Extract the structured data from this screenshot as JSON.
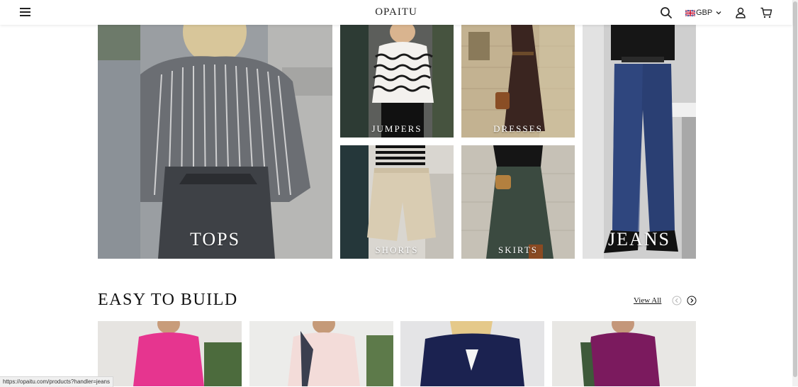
{
  "header": {
    "logo": "OPAITU",
    "currency": "GBP",
    "icons": [
      "menu-icon",
      "search-icon",
      "flag-uk-icon",
      "chevron-down-icon",
      "user-icon",
      "cart-icon"
    ]
  },
  "categories": [
    {
      "label": "TOPS"
    },
    {
      "label": "JUMPERS"
    },
    {
      "label": "DRESSES"
    },
    {
      "label": "JEANS"
    },
    {
      "label": "SHORTS"
    },
    {
      "label": "SKIRTS"
    }
  ],
  "section": {
    "title": "EASY TO BUILD",
    "view_all": "View All"
  },
  "products": [
    {
      "color": "#e6358f"
    },
    {
      "color": "#f3dcd9"
    },
    {
      "color": "#1b2250"
    },
    {
      "color": "#7b1a5e"
    }
  ],
  "status_bar": {
    "url": "https://opaitu.com/products?handler=jeans"
  }
}
